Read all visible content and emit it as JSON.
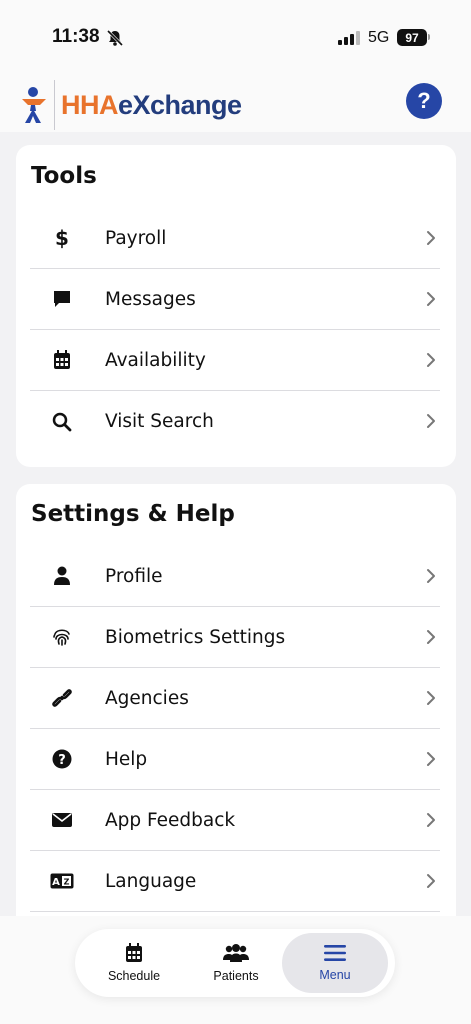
{
  "status_bar": {
    "time": "11:38",
    "network": "5G",
    "battery": "97"
  },
  "header": {
    "logo_hha": "HHA",
    "logo_exchange": "eXchange",
    "help_label": "?"
  },
  "tools": {
    "title": "Tools",
    "items": [
      {
        "label": "Payroll",
        "icon": "dollar-icon"
      },
      {
        "label": "Messages",
        "icon": "message-icon"
      },
      {
        "label": "Availability",
        "icon": "calendar-icon"
      },
      {
        "label": "Visit Search",
        "icon": "search-icon"
      }
    ]
  },
  "settings": {
    "title": "Settings & Help",
    "items": [
      {
        "label": "Profile",
        "icon": "person-icon"
      },
      {
        "label": "Biometrics Settings",
        "icon": "fingerprint-icon"
      },
      {
        "label": "Agencies",
        "icon": "link-icon"
      },
      {
        "label": "Help",
        "icon": "question-circle-icon"
      },
      {
        "label": "App Feedback",
        "icon": "envelope-icon"
      },
      {
        "label": "Language",
        "icon": "language-icon"
      }
    ]
  },
  "tabbar": {
    "tabs": [
      {
        "label": "Schedule",
        "icon": "calendar-icon"
      },
      {
        "label": "Patients",
        "icon": "people-icon"
      },
      {
        "label": "Menu",
        "icon": "hamburger-icon",
        "active": true
      }
    ]
  },
  "colors": {
    "accent": "#2646a6",
    "brand_orange": "#e8732c",
    "brand_navy": "#233d7d"
  }
}
